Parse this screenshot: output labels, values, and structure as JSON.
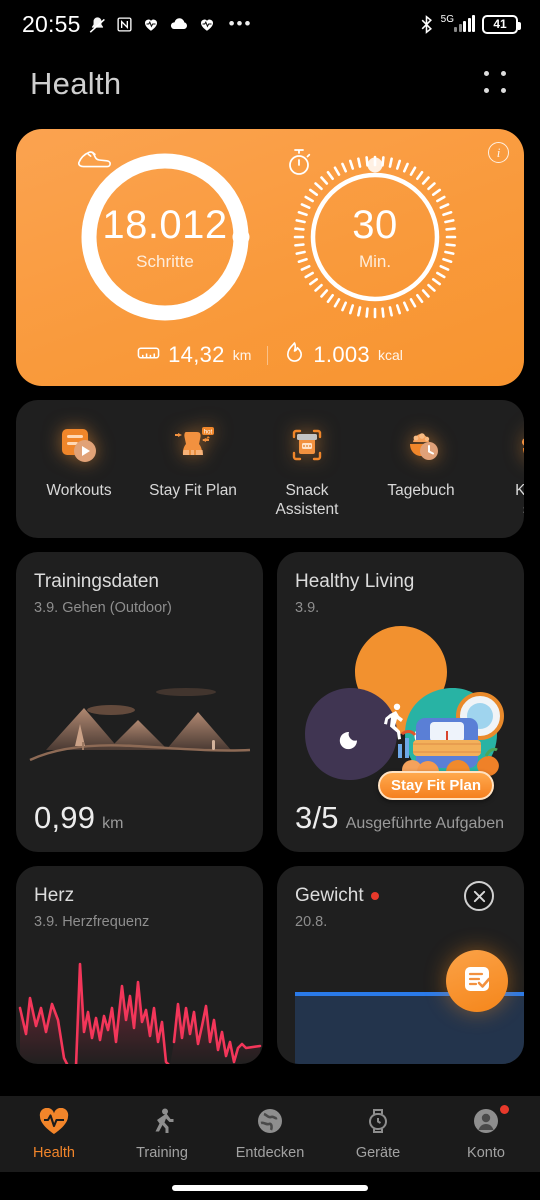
{
  "statusbar": {
    "time": "20:55",
    "icons": [
      "mute-icon",
      "nfc-icon",
      "heart-icon",
      "cloud-icon",
      "heart-icon",
      "more-icon"
    ],
    "bluetooth": "bluetooth-icon",
    "network": "5G",
    "battery_level": "41"
  },
  "header": {
    "title": "Health",
    "menu_icon": "grid-dots-icon"
  },
  "hero": {
    "info_label": "i",
    "steps": {
      "value": "18.012",
      "unit": "Schritte",
      "icon": "shoe-icon",
      "progress_percent": 100
    },
    "minutes": {
      "value": "30",
      "unit": "Min.",
      "icon": "stopwatch-icon",
      "progress_percent": 100
    },
    "distance": {
      "value": "14,32",
      "unit": "km",
      "icon": "ruler-icon"
    },
    "calories": {
      "value": "1.003",
      "unit": "kcal",
      "icon": "flame-icon"
    },
    "accent_color": "#f89a3c"
  },
  "shortcuts": [
    {
      "label": "Workouts",
      "icon": "workout-video-icon"
    },
    {
      "label": "Stay Fit Plan",
      "icon": "body-shape-icon"
    },
    {
      "label": "Snack\nAssistent",
      "icon": "scan-food-icon"
    },
    {
      "label": "Tagebuch",
      "icon": "food-bowl-clock-icon"
    },
    {
      "label": "Klang\nsch",
      "icon": "sound-landscape-icon"
    }
  ],
  "cards": [
    {
      "title": "Trainingsdaten",
      "subtitle": "3.9.  Gehen (Outdoor)",
      "value": "0,99",
      "unit": "km",
      "art": "mountain-landscape"
    },
    {
      "title": "Healthy Living",
      "subtitle": "3.9.",
      "value": "3/5",
      "unit": "Ausgeführte Aufgaben",
      "art": "three-blobs"
    },
    {
      "title": "Herz",
      "badge": true,
      "subtitle": "3.9.  Herzfrequenz",
      "art": "heart-rate-chart",
      "chart_color": "#f3365a"
    },
    {
      "title": "Gewicht",
      "badge": true,
      "subtitle": "20.8.",
      "art": "weight-line-chart",
      "chart_color": "#2a7ae9"
    }
  ],
  "promo": {
    "label": "Stay Fit Plan",
    "close_icon": "close-icon"
  },
  "fab": {
    "icon": "checklist-icon"
  },
  "bottomnav": [
    {
      "label": "Health",
      "icon": "heart-pulse-icon",
      "active": true
    },
    {
      "label": "Training",
      "icon": "runner-icon",
      "active": false
    },
    {
      "label": "Entdecken",
      "icon": "globe-icon",
      "active": false
    },
    {
      "label": "Geräte",
      "icon": "watch-icon",
      "active": false
    },
    {
      "label": "Konto",
      "icon": "person-icon",
      "active": false,
      "badge": true
    }
  ]
}
